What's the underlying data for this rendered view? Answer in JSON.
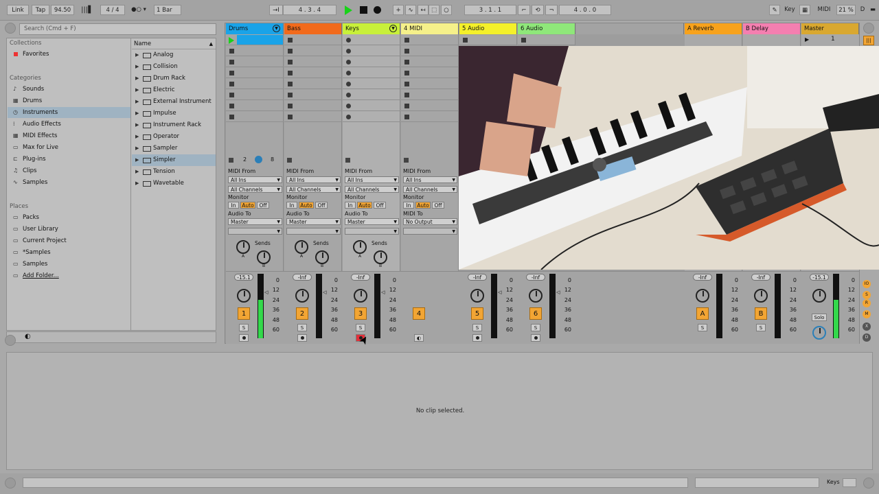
{
  "transport": {
    "link": "Link",
    "tap": "Tap",
    "tempo": "94.50",
    "signature": "4 / 4",
    "quantize": "1 Bar",
    "arrangement_position": "4 . 3 . 4",
    "loop_start": "3 . 1 . 1",
    "loop_length": "4 . 0 . 0",
    "key_label": "Key",
    "midi_label": "MIDI",
    "cpu": "21 %",
    "disk": "D"
  },
  "browser": {
    "search_placeholder": "Search (Cmd + F)",
    "collections_header": "Collections",
    "favorites": "Favorites",
    "categories_header": "Categories",
    "categories": [
      "Sounds",
      "Drums",
      "Instruments",
      "Audio Effects",
      "MIDI Effects",
      "Max for Live",
      "Plug-ins",
      "Clips",
      "Samples"
    ],
    "places_header": "Places",
    "places": [
      "Packs",
      "User Library",
      "Current Project",
      "*Samples",
      "Samples",
      "Add Folder..."
    ],
    "name_header": "Name",
    "items": [
      "Analog",
      "Collision",
      "Drum Rack",
      "Electric",
      "External Instrument",
      "Impulse",
      "Instrument Rack",
      "Operator",
      "Sampler",
      "Simpler",
      "Tension",
      "Wavetable"
    ]
  },
  "tracks": [
    {
      "name": "Drums",
      "color": "#1aa3e8",
      "number": "1",
      "volume": "-15.1"
    },
    {
      "name": "Bass",
      "color": "#f26a1b",
      "number": "2",
      "volume": "-Inf"
    },
    {
      "name": "Keys",
      "color": "#c8f03a",
      "number": "3",
      "volume": "-Inf"
    },
    {
      "name": "4 MIDI",
      "color": "#f5f08a",
      "number": "4",
      "volume": ""
    },
    {
      "name": "5 Audio",
      "color": "#f4f02a",
      "number": "5",
      "volume": "-Inf"
    },
    {
      "name": "6 Audio",
      "color": "#8fe77a",
      "number": "6",
      "volume": "-Inf"
    }
  ],
  "returns": [
    {
      "name": "A Reverb",
      "color": "#f7a21c",
      "letter": "A",
      "volume": "-Inf"
    },
    {
      "name": "B Delay",
      "color": "#f47fb0",
      "letter": "B",
      "volume": "-Inf"
    }
  ],
  "master": {
    "name": "Master",
    "color": "#d9a830",
    "volume": "-15.1",
    "scene": "1",
    "solo": "Solo"
  },
  "io": {
    "midi_from": "MIDI From",
    "all_ins": "All Ins",
    "all_channels": "All Channels",
    "monitor": "Monitor",
    "in": "In",
    "auto": "Auto",
    "off": "Off",
    "audio_to": "Audio To",
    "midi_to": "MIDI To",
    "master": "Master",
    "no_output": "No Output",
    "sends": "Sends",
    "a": "A",
    "b": "B",
    "s": "S",
    "drum_pads_left": "2",
    "drum_pads_right": "8"
  },
  "db_scale": [
    "0",
    "12",
    "24",
    "36",
    "48",
    "60"
  ],
  "detail": {
    "message": "No clip selected."
  },
  "status": {
    "keys_label": "Keys"
  }
}
